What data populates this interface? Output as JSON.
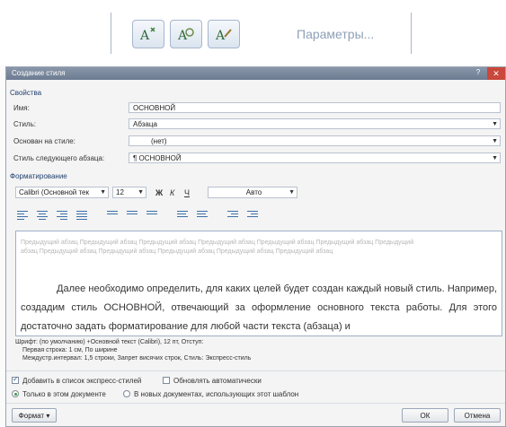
{
  "ribbon": {
    "parameters_link": "Параметры..."
  },
  "dialog": {
    "title": "Создание стиля",
    "help": "?",
    "close": "✕",
    "properties_header": "Свойства",
    "name_label": "Имя:",
    "name_value": "ОСНОВНОЙ",
    "style_label": "Стиль:",
    "style_value": "Абзаца",
    "based_on_label": "Основан на стиле:",
    "based_on_value": "(нет)",
    "next_style_label": "Стиль следующего абзаца:",
    "next_style_value": "¶ ОСНОВНОЙ",
    "formatting_header": "Форматирование",
    "font": "Calibri (Основной тек",
    "size": "12",
    "bold": "Ж",
    "italic": "К",
    "underline": "Ч",
    "color": "Авто",
    "preview_grey": "Предыдущий абзац Предыдущий абзац Предыдущий абзац Предыдущий абзац Предыдущий абзац Предыдущий абзац Предыдущий абзац Предыдущий абзац Предыдущий абзац Предыдущий абзац Предыдущий абзац Предыдущий абзац",
    "preview_main": "Далее необходимо определить, для каких целей будет создан каждый новый стиль. Например, создадим стиль ОСНОВНОЙ, отвечающий за оформление основного текста работы. Для этого достаточно задать форматирование для любой части текста (абзаца) и",
    "description_lines": [
      "Шрифт: (по умолчанию) +Основной текст (Calibri), 12 пт, Отступ:",
      "Первая строка: 1 см, По ширине",
      "Междустр.интервал: 1,5 строки, Запрет висячих строк, Стиль: Экспресс-стиль"
    ],
    "add_to_quick_label": "Добавить в список экспресс-стилей",
    "auto_update_label": "Обновлять автоматически",
    "only_this_doc_label": "Только в этом документе",
    "new_docs_label": "В новых документах, использующих этот шаблон",
    "format_button": "Формат ▾",
    "ok_button": "ОК",
    "cancel_button": "Отмена"
  }
}
